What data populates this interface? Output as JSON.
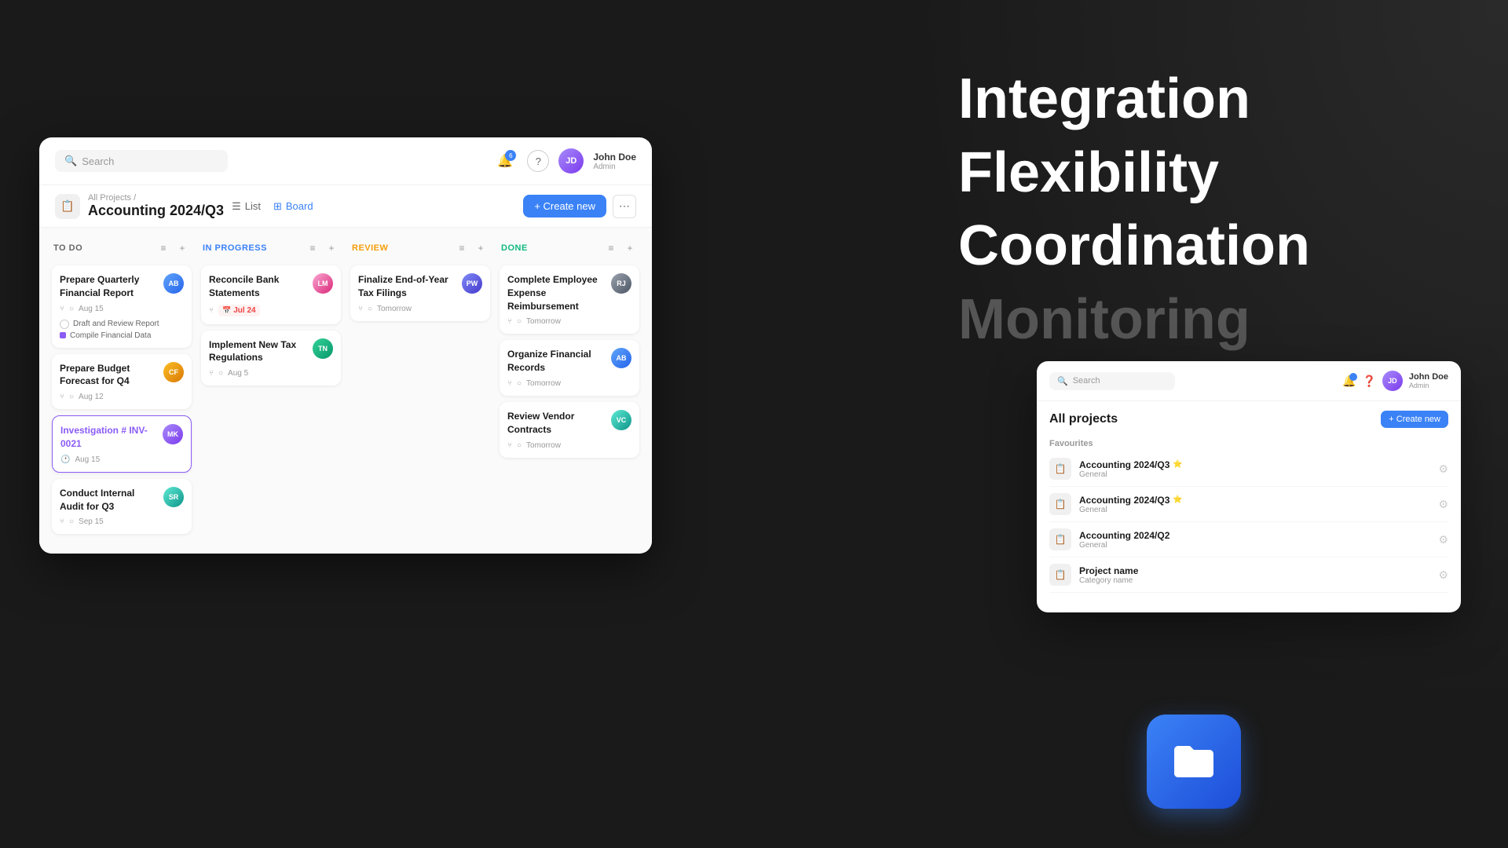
{
  "background": {
    "color": "#1a1a1a"
  },
  "features": {
    "words": [
      {
        "label": "Integration",
        "dimmed": false
      },
      {
        "label": "Flexibility",
        "dimmed": false
      },
      {
        "label": "Coordination",
        "dimmed": false
      },
      {
        "label": "Monitoring",
        "dimmed": true
      }
    ]
  },
  "kanban": {
    "header": {
      "search_placeholder": "Search",
      "notifications_count": "6",
      "help_label": "?",
      "user_name": "John Doe",
      "user_role": "Admin",
      "user_initials": "JD"
    },
    "project": {
      "breadcrumb": "All Projects /",
      "title": "Accounting 2024/Q3",
      "icon": "📋",
      "view_list": "List",
      "view_board": "Board",
      "create_btn": "+ Create new",
      "more_btn": "⋯"
    },
    "columns": [
      {
        "id": "todo",
        "title": "TO DO",
        "cards": [
          {
            "title": "Prepare Quarterly Financial Report",
            "avatar_class": "av-blue",
            "avatar_initials": "AB",
            "date": "Aug 15",
            "subtasks": [
              {
                "label": "Draft and Review Report",
                "color": "blue"
              },
              {
                "label": "Compile Financial Data",
                "color": "purple"
              }
            ]
          },
          {
            "title": "Prepare Budget Forecast for Q4",
            "avatar_class": "av-orange",
            "avatar_initials": "CF",
            "date": "Aug 12",
            "subtasks": []
          },
          {
            "title": "Investigation # INV-0021",
            "avatar_class": "av-purple",
            "avatar_initials": "MK",
            "date": "Aug 15",
            "highlight": true,
            "subtasks": []
          },
          {
            "title": "Conduct Internal Audit for Q3",
            "avatar_class": "av-teal",
            "avatar_initials": "SR",
            "date": "Sep 15",
            "subtasks": []
          }
        ]
      },
      {
        "id": "inprogress",
        "title": "IN PROGRESS",
        "cards": [
          {
            "title": "Reconcile Bank Statements",
            "avatar_class": "av-pink",
            "avatar_initials": "LM",
            "date": "Jul 24",
            "overdue": true,
            "subtasks": []
          },
          {
            "title": "Implement New Tax Regulations",
            "avatar_class": "av-green",
            "avatar_initials": "TN",
            "date": "Aug 5",
            "subtasks": []
          }
        ]
      },
      {
        "id": "review",
        "title": "REVIEW",
        "cards": [
          {
            "title": "Finalize End-of-Year Tax Filings",
            "avatar_class": "av-indigo",
            "avatar_initials": "PW",
            "date": "Tomorrow",
            "subtasks": []
          }
        ]
      },
      {
        "id": "done",
        "title": "DONE",
        "cards": [
          {
            "title": "Complete Employee Expense Reimbursement",
            "avatar_class": "av-gray",
            "avatar_initials": "RJ",
            "date": "Tomorrow",
            "subtasks": []
          },
          {
            "title": "Organize Financial Records",
            "avatar_class": "av-blue",
            "avatar_initials": "AB",
            "date": "Tomorrow",
            "subtasks": []
          },
          {
            "title": "Review Vendor Contracts",
            "avatar_class": "av-teal",
            "avatar_initials": "VC",
            "date": "Tomorrow",
            "subtasks": []
          }
        ]
      }
    ]
  },
  "projects_window": {
    "search_placeholder": "Search",
    "user_name": "John Doe",
    "user_role": "Admin",
    "user_initials": "JD",
    "title": "All projects",
    "create_btn": "+ Create new",
    "sections": [
      {
        "label": "Favourites",
        "items": [
          {
            "name": "Accounting 2024/Q3",
            "category": "General",
            "starred": true
          },
          {
            "name": "Accounting 2024/Q3",
            "category": "General",
            "starred": true
          }
        ]
      },
      {
        "label": "",
        "items": [
          {
            "name": "Accounting 2024/Q2",
            "category": "General",
            "starred": false
          },
          {
            "name": "Project name",
            "category": "Category name",
            "starred": false
          }
        ]
      }
    ]
  },
  "folder_icon": {
    "label": "Folder"
  }
}
